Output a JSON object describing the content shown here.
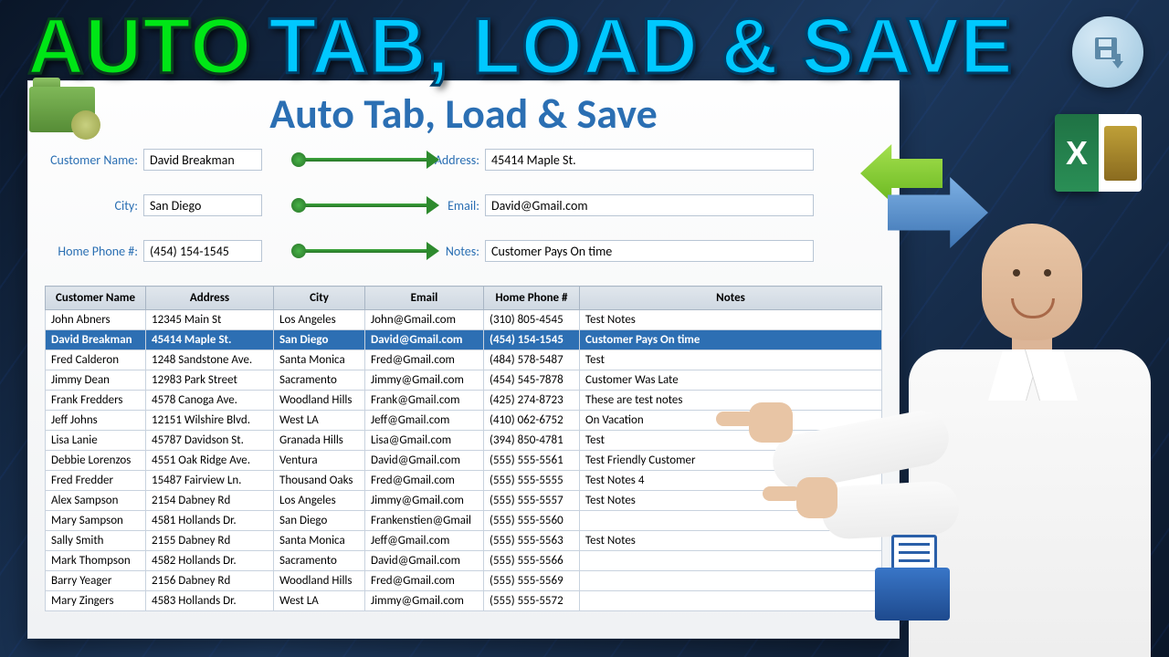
{
  "headline": {
    "word1": "AUTO",
    "word2": "TAB, LOAD & SAVE"
  },
  "panel_title": "Auto Tab, Load & Save",
  "form": {
    "customer_name": {
      "label": "Customer Name:",
      "value": "David Breakman"
    },
    "address": {
      "label": "Address:",
      "value": "45414 Maple St."
    },
    "city": {
      "label": "City:",
      "value": "San Diego"
    },
    "email": {
      "label": "Email:",
      "value": "David@Gmail.com"
    },
    "home_phone": {
      "label": "Home Phone #:",
      "value": "(454) 154-1545"
    },
    "notes": {
      "label": "Notes:",
      "value": "Customer Pays On time"
    }
  },
  "table": {
    "headers": [
      "Customer Name",
      "Address",
      "City",
      "Email",
      "Home Phone #",
      "Notes"
    ],
    "rows": [
      {
        "sel": false,
        "c": [
          "John Abners",
          "12345 Main St",
          "Los Angeles",
          "John@Gmail.com",
          "(310) 805-4545",
          "Test Notes"
        ]
      },
      {
        "sel": true,
        "c": [
          "David Breakman",
          "45414 Maple St.",
          "San Diego",
          "David@Gmail.com",
          "(454) 154-1545",
          "Customer Pays On time"
        ]
      },
      {
        "sel": false,
        "c": [
          "Fred Calderon",
          "1248 Sandstone Ave.",
          "Santa Monica",
          "Fred@Gmail.com",
          "(484) 578-5487",
          "Test"
        ]
      },
      {
        "sel": false,
        "c": [
          "Jimmy Dean",
          "12983 Park Street",
          "Sacramento",
          "Jimmy@Gmail.com",
          "(454) 545-7878",
          "Customer Was Late"
        ]
      },
      {
        "sel": false,
        "c": [
          "Frank Fredders",
          "4578 Canoga Ave.",
          "Woodland Hills",
          "Frank@Gmail.com",
          "(425) 274-8723",
          "These are test notes"
        ]
      },
      {
        "sel": false,
        "c": [
          "Jeff Johns",
          "12151 Wilshire Blvd.",
          "West LA",
          "Jeff@Gmail.com",
          "(410) 062-6752",
          "On Vacation"
        ]
      },
      {
        "sel": false,
        "c": [
          "Lisa Lanie",
          "45787 Davidson St.",
          "Granada Hills",
          "Lisa@Gmail.com",
          "(394) 850-4781",
          "Test"
        ]
      },
      {
        "sel": false,
        "c": [
          "Debbie Lorenzos",
          "4551 Oak Ridge Ave.",
          "Ventura",
          "David@Gmail.com",
          "(555) 555-5561",
          "Test Friendly Customer"
        ]
      },
      {
        "sel": false,
        "c": [
          "Fred Fredder",
          "15487 Fairview Ln.",
          "Thousand Oaks",
          "Fred@Gmail.com",
          "(555) 555-5555",
          "Test Notes 4"
        ]
      },
      {
        "sel": false,
        "c": [
          "Alex Sampson",
          "2154 Dabney Rd",
          "Los Angeles",
          "Jimmy@Gmail.com",
          "(555) 555-5557",
          "Test Notes"
        ]
      },
      {
        "sel": false,
        "c": [
          "Mary Sampson",
          "4581 Hollands Dr.",
          "San Diego",
          "Frankenstien@Gmail",
          "(555) 555-5560",
          ""
        ]
      },
      {
        "sel": false,
        "c": [
          "Sally Smith",
          "2155 Dabney Rd",
          "Santa Monica",
          "Jeff@Gmail.com",
          "(555) 555-5563",
          "Test Notes"
        ]
      },
      {
        "sel": false,
        "c": [
          "Mark Thompson",
          "4582 Hollands Dr.",
          "Sacramento",
          "David@Gmail.com",
          "(555) 555-5566",
          ""
        ]
      },
      {
        "sel": false,
        "c": [
          "Barry Yeager",
          "2156 Dabney Rd",
          "Woodland Hills",
          "Fred@Gmail.com",
          "(555) 555-5569",
          ""
        ]
      },
      {
        "sel": false,
        "c": [
          "Mary Zingers",
          "4583 Hollands Dr.",
          "West LA",
          "Jimmy@Gmail.com",
          "(555) 555-5572",
          ""
        ]
      }
    ]
  },
  "icons": {
    "save": "save-download-icon",
    "excel": "X",
    "folder": "folder-gear-icon",
    "document": "document-folder-icon"
  },
  "colors": {
    "accent": "#2b6fb3",
    "green": "#00e616",
    "cyan": "#00c8ff"
  }
}
